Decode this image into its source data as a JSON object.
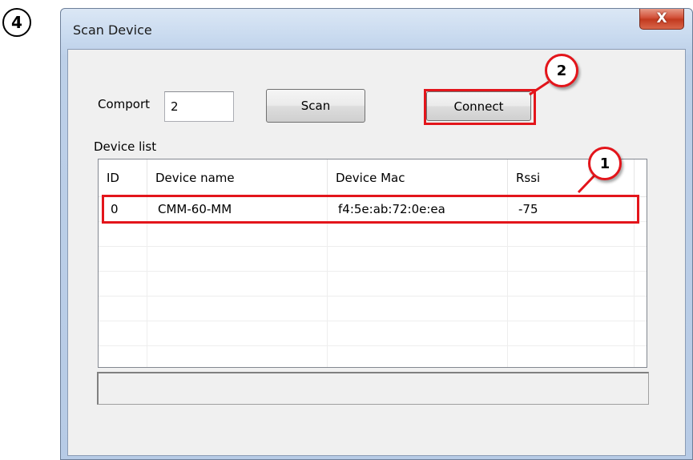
{
  "step_badge": "4",
  "window": {
    "title": "Scan Device",
    "close_glyph": "X"
  },
  "comport": {
    "label": "Comport",
    "value": "2"
  },
  "buttons": {
    "scan": "Scan",
    "connect": "Connect"
  },
  "device_list": {
    "label": "Device list",
    "columns": [
      "ID",
      "Device name",
      "Device Mac",
      "Rssi"
    ],
    "rows": [
      [
        "0",
        "CMM-60-MM",
        "f4:5e:ab:72:0e:ea",
        "-75"
      ]
    ]
  },
  "status": {
    "text": ""
  },
  "callouts": {
    "one": "1",
    "two": "2"
  },
  "colors": {
    "highlight": "#e3151b",
    "title_bar": "#c6d8ee",
    "close_button": "#c23a1f",
    "client_bg": "#f0f0f0"
  }
}
